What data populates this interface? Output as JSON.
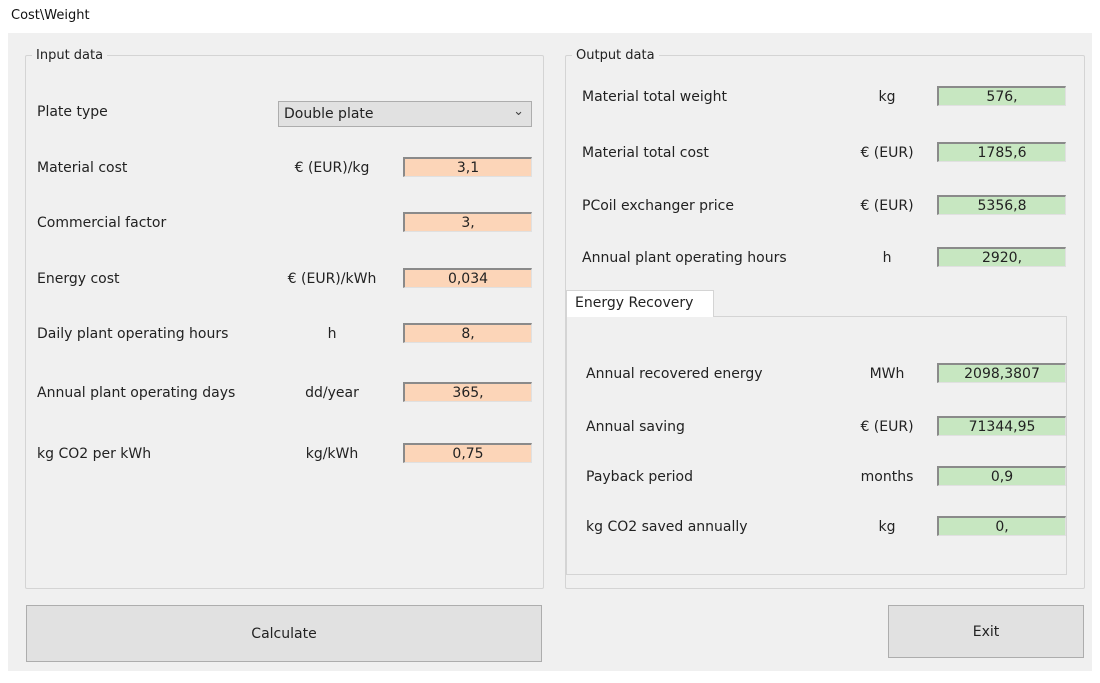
{
  "window": {
    "title": "Cost\\Weight"
  },
  "input": {
    "legend": "Input data",
    "plate_type": {
      "label": "Plate type",
      "selected": "Double plate"
    },
    "rows": [
      {
        "label": "Material cost",
        "unit": "€ (EUR)/kg",
        "value": "3,1"
      },
      {
        "label": "Commercial factor",
        "unit": "",
        "value": "3,"
      },
      {
        "label": "Energy cost",
        "unit": "€ (EUR)/kWh",
        "value": "0,034"
      },
      {
        "label": "Daily plant operating hours",
        "unit": "h",
        "value": "8,"
      },
      {
        "label": "Annual plant operating days",
        "unit": "dd/year",
        "value": "365,"
      },
      {
        "label": "kg CO2 per kWh",
        "unit": "kg/kWh",
        "value": "0,75"
      }
    ]
  },
  "output": {
    "legend": "Output data",
    "rows": [
      {
        "label": "Material total weight",
        "unit": "kg",
        "value": "576,"
      },
      {
        "label": "Material total cost",
        "unit": "€ (EUR)",
        "value": "1785,6"
      },
      {
        "label": "PCoil exchanger price",
        "unit": "€ (EUR)",
        "value": "5356,8"
      },
      {
        "label": "Annual plant operating hours",
        "unit": "h",
        "value": "2920,"
      }
    ]
  },
  "energy_recovery": {
    "tab_label": "Energy Recovery",
    "rows": [
      {
        "label": "Annual recovered energy",
        "unit": "MWh",
        "value": "2098,3807"
      },
      {
        "label": "Annual saving",
        "unit": "€ (EUR)",
        "value": "71344,95"
      },
      {
        "label": "Payback period",
        "unit": "months",
        "value": "0,9"
      },
      {
        "label": "kg CO2 saved annually",
        "unit": "kg",
        "value": "0,"
      }
    ]
  },
  "buttons": {
    "calculate": "Calculate",
    "exit": "Exit"
  },
  "colors": {
    "input_field": "#fcd5b8",
    "output_field": "#c7e7c1",
    "background": "#f0f0f0"
  }
}
